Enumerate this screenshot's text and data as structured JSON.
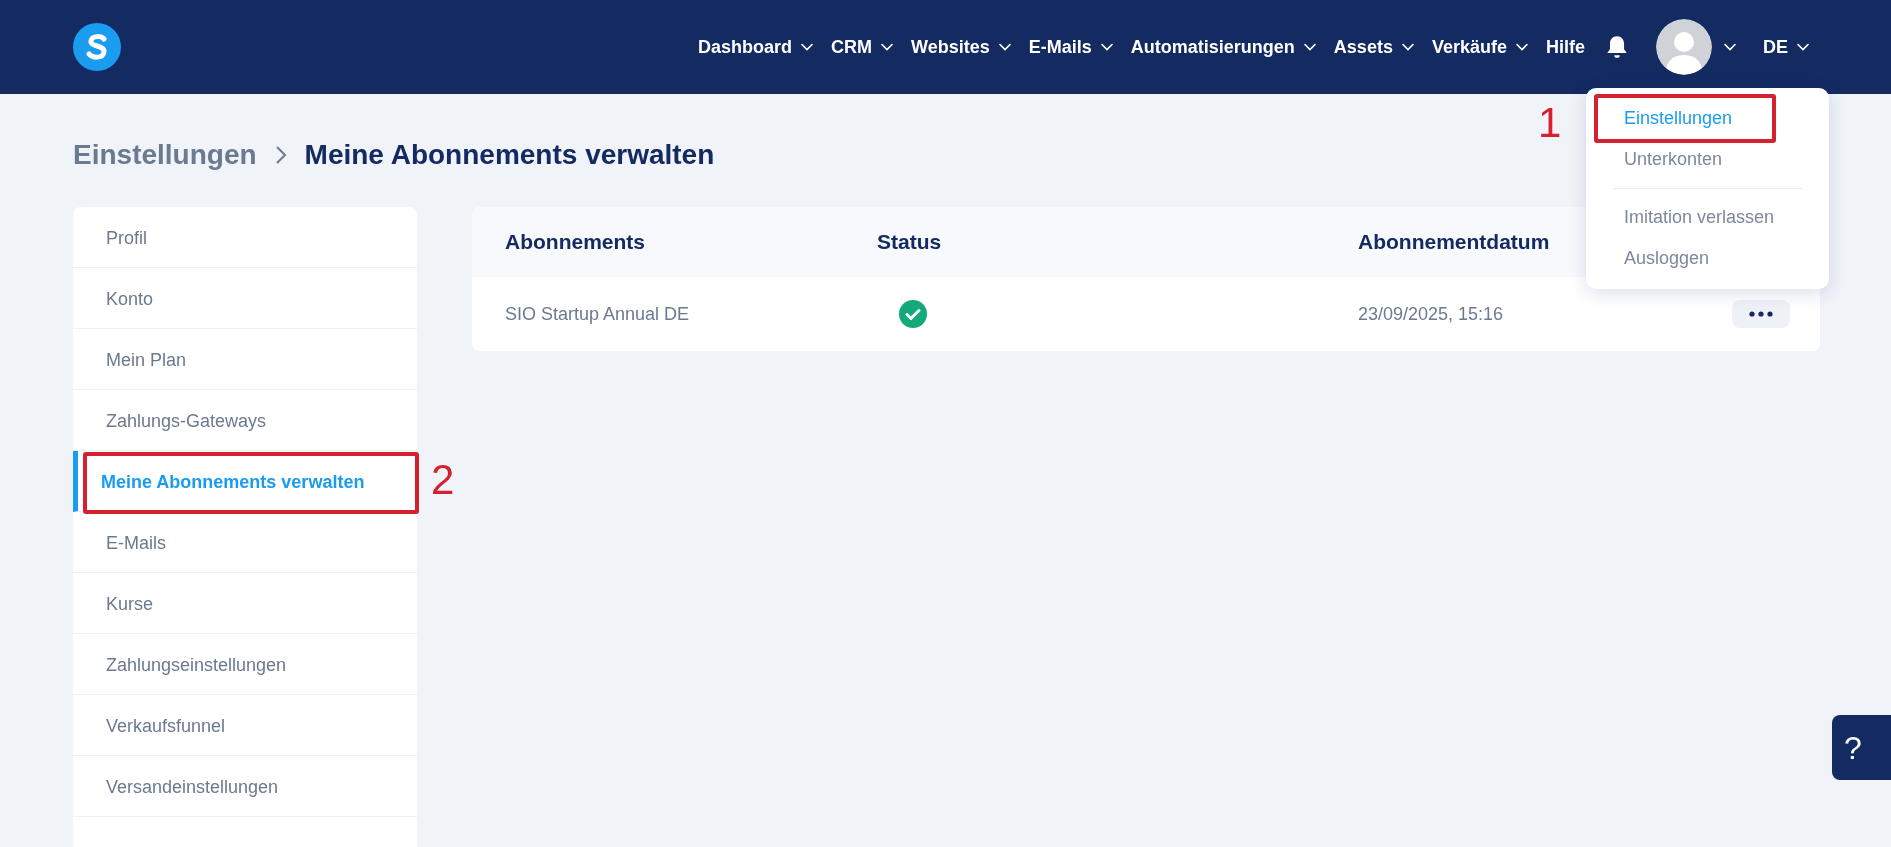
{
  "navbar": {
    "items": [
      {
        "label": "Dashboard",
        "has_dropdown": true
      },
      {
        "label": "CRM",
        "has_dropdown": true
      },
      {
        "label": "Websites",
        "has_dropdown": true
      },
      {
        "label": "E-Mails",
        "has_dropdown": true
      },
      {
        "label": "Automatisierungen",
        "has_dropdown": true
      },
      {
        "label": "Assets",
        "has_dropdown": true
      },
      {
        "label": "Verkäufe",
        "has_dropdown": true
      },
      {
        "label": "Hilfe",
        "has_dropdown": false
      }
    ],
    "language": "DE"
  },
  "user_menu": {
    "groups": [
      [
        {
          "label": "Einstellungen",
          "selected": true,
          "annotation": "1"
        },
        {
          "label": "Unterkonten",
          "selected": false
        }
      ],
      [
        {
          "label": "Imitation verlassen",
          "selected": false
        },
        {
          "label": "Ausloggen",
          "selected": false
        }
      ]
    ]
  },
  "breadcrumb": [
    "Einstellungen",
    "Meine Abonnements verwalten"
  ],
  "sidebar": {
    "items": [
      {
        "label": "Profil",
        "selected": false
      },
      {
        "label": "Konto",
        "selected": false
      },
      {
        "label": "Mein Plan",
        "selected": false
      },
      {
        "label": "Zahlungs-Gateways",
        "selected": false
      },
      {
        "label": "Meine Abonnements verwalten",
        "selected": true,
        "annotation": "2"
      },
      {
        "label": "E-Mails",
        "selected": false
      },
      {
        "label": "Kurse",
        "selected": false
      },
      {
        "label": "Zahlungseinstellungen",
        "selected": false
      },
      {
        "label": "Verkaufsfunnel",
        "selected": false
      },
      {
        "label": "Versandeinstellungen",
        "selected": false
      }
    ]
  },
  "table": {
    "columns": [
      "Abonnements",
      "Status",
      "Abonnementdatum"
    ],
    "rows": [
      {
        "name": "SIO Startup Annual DE",
        "verified": true,
        "date": "23/09/2025, 15:16"
      }
    ]
  },
  "help_button": "?"
}
